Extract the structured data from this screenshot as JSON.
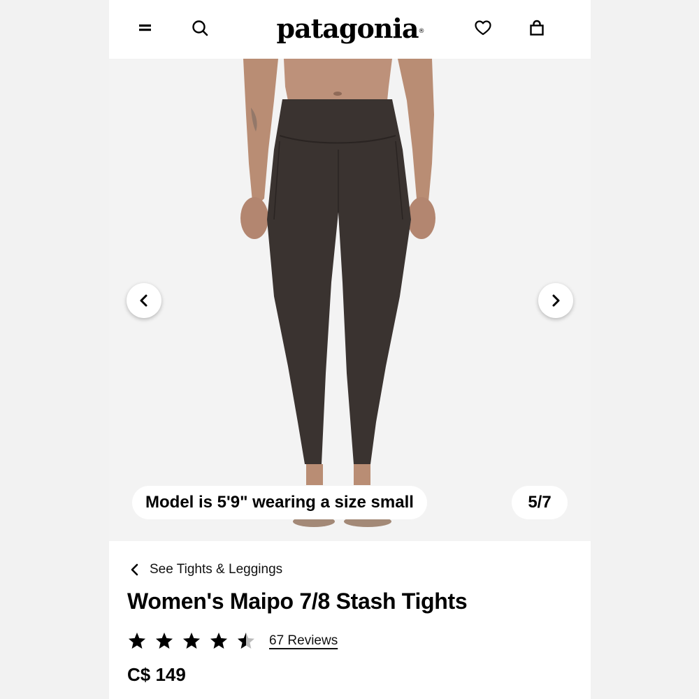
{
  "header": {
    "brand": "patagonia",
    "brand_mark": "®",
    "icons": [
      "menu-icon",
      "search-icon",
      "heart-icon",
      "bag-icon"
    ]
  },
  "gallery": {
    "caption": "Model is 5'9\" wearing a size small",
    "counter": "5/7",
    "current_image": 5,
    "total_images": 7,
    "icons": [
      "chevron-left-icon",
      "chevron-right-icon"
    ]
  },
  "product": {
    "breadcrumb": "See Tights & Leggings",
    "title": "Women's Maipo 7/8 Stash Tights",
    "rating": 4.5,
    "rating_max": 5,
    "reviews_label": "67 Reviews",
    "price": "C$ 149"
  },
  "colors": {
    "text": "#000000",
    "tights": "#3a3330",
    "skin": "#b98d74",
    "gallery_bg": "#f3f3f3"
  }
}
